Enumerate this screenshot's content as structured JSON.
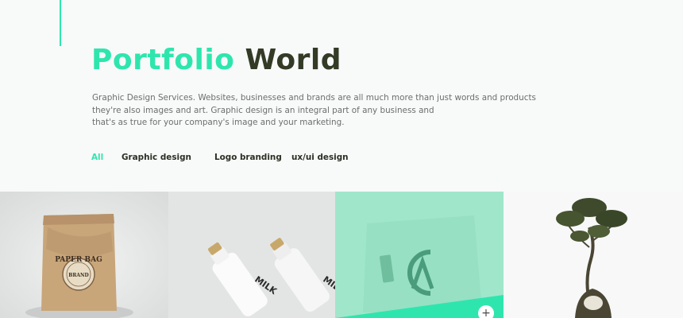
{
  "header": {
    "title_accent": "Portfolio",
    "title_rest": "World",
    "description": [
      "Graphic Design Services. Websites, businesses and brands are all much more than just words and products",
      "they're also images and art. Graphic design is an integral part of any business and",
      "that's as true for your company's image and your marketing."
    ]
  },
  "filters": [
    {
      "label": "All",
      "active": true
    },
    {
      "label": "Graphic design",
      "active": false
    },
    {
      "label": "Logo branding",
      "active": false
    },
    {
      "label": "ux/ui design",
      "active": false
    }
  ],
  "gallery": {
    "items": [
      {
        "subject": "paper-bag",
        "bag_text": "PAPER BAG",
        "badge_text": "BRAND"
      },
      {
        "subject": "milk-bottles",
        "bottle_text": "MILK"
      },
      {
        "subject": "shopping-bag-logo"
      },
      {
        "subject": "bonsai-plant"
      }
    ],
    "expand_icon": "plus-icon"
  },
  "colors": {
    "accent": "#2ee6ad",
    "title_dark": "#333a26",
    "text_gray": "#6b6f6e"
  }
}
